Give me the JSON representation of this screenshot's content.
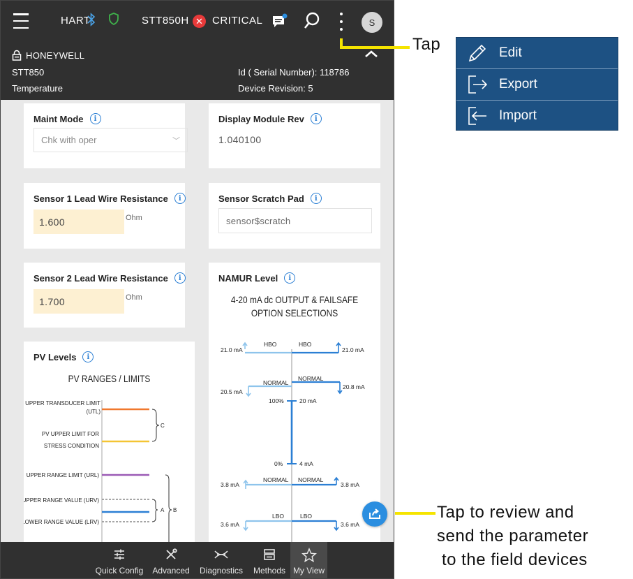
{
  "colors": {
    "bar": "#303030",
    "accent": "#2b8ee0",
    "critical": "#e83a3a",
    "menu_bg": "#1d5183",
    "highlight_input": "#fdf0d2",
    "callout_line": "#f5e400"
  },
  "topbar": {
    "protocol": "HART",
    "device": "STT850H",
    "status": "CRITICAL",
    "avatar": "S",
    "icons": [
      "menu-icon",
      "bluetooth-icon",
      "shield-icon",
      "critical-icon",
      "chat-icon",
      "search-icon",
      "kebab-icon"
    ]
  },
  "device": {
    "manufacturer": "HONEYWELL",
    "model": "STT850",
    "type": "Temperature",
    "serial": "Id ( Serial Number): 118786",
    "revision": "Device Revision: 5"
  },
  "cards": {
    "maint_mode": {
      "title": "Maint Mode",
      "value": "Chk with oper"
    },
    "display_rev": {
      "title": "Display Module Rev",
      "value": "1.040100"
    },
    "sensor1": {
      "title": "Sensor 1 Lead Wire Resistance",
      "value": "1.600",
      "unit": "Ohm"
    },
    "scratch": {
      "title": "Sensor Scratch Pad",
      "value": "sensor$scratch"
    },
    "sensor2": {
      "title": "Sensor 2 Lead Wire Resistance",
      "value": "1.700",
      "unit": "Ohm"
    },
    "namur": {
      "title": "NAMUR Level",
      "figure_title_1": "4-20 mA dc OUTPUT & FAILSAFE",
      "figure_title_2": "OPTION SELECTIONS",
      "labels": {
        "l_hbo_ma": "21.0 mA",
        "l_hbo": "HBO",
        "r_hbo": "HBO",
        "r_hbo_ma": "21.0 mA",
        "l_norm_top_ma": "20.5 mA",
        "l_norm_top": "NORMAL",
        "r_norm_top": "NORMAL",
        "r_norm_top_ma": "20.8 mA",
        "pct100": "100%",
        "ma20": "20 mA",
        "pct0": "0%",
        "ma4": "4 mA",
        "l_norm_bot_ma": "3.8 mA",
        "l_norm_bot": "NORMAL",
        "r_norm_bot": "NORMAL",
        "r_norm_bot_ma": "3.8 mA",
        "l_lbo_ma": "3.6 mA",
        "l_lbo": "LBO",
        "r_lbo": "LBO",
        "r_lbo_ma": "3.6 mA"
      }
    },
    "pv_levels": {
      "title": "PV Levels",
      "figure_title": "PV RANGES / LIMITS",
      "labels": {
        "utl_1": "UPPER TRANSDUCER LIMIT",
        "utl_2": "(UTL)",
        "stress_1": "PV UPPER LIMIT FOR",
        "stress_2": "STRESS CONDITION",
        "url": "UPPER RANGE LIMIT (URL)",
        "urv": "UPPER RANGE VALUE (URV)",
        "lrv": "LOWER RANGE VALUE (LRV)",
        "brace_c": "C",
        "brace_a": "A",
        "brace_b": "B"
      }
    }
  },
  "nav": [
    {
      "label": "Quick Config",
      "icon": "sliders-icon"
    },
    {
      "label": "Advanced",
      "icon": "tools-icon"
    },
    {
      "label": "Diagnostics",
      "icon": "dna-icon"
    },
    {
      "label": "Methods",
      "icon": "methods-icon"
    },
    {
      "label": "My View",
      "icon": "star-icon",
      "selected": true
    }
  ],
  "popup_menu": [
    {
      "label": "Edit",
      "icon": "pencil-icon"
    },
    {
      "label": "Export",
      "icon": "export-icon"
    },
    {
      "label": "Import",
      "icon": "import-icon"
    }
  ],
  "callouts": {
    "tap": "Tap",
    "send_1": "Tap to review and",
    "send_2": "send the parameter",
    "send_3": "to the field devices"
  }
}
